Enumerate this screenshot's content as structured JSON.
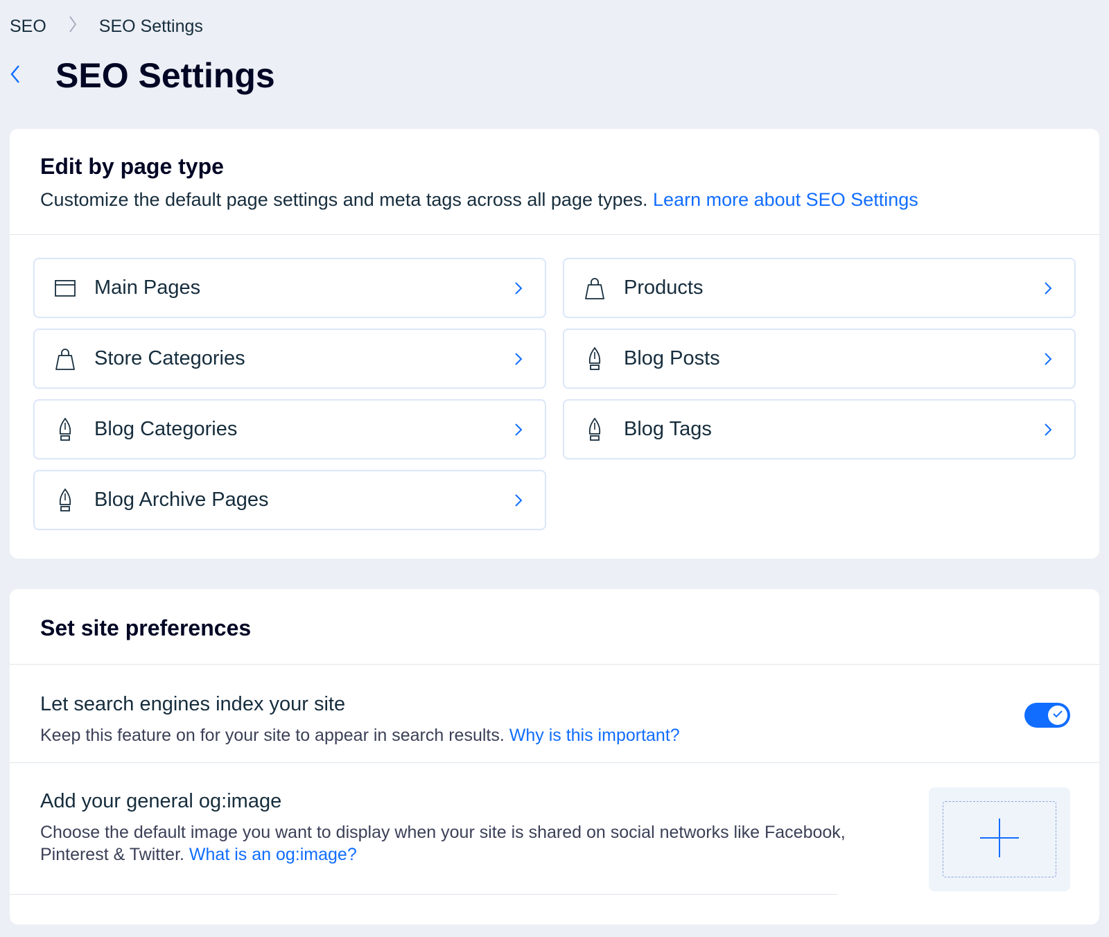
{
  "breadcrumb": {
    "root": "SEO",
    "current": "SEO Settings"
  },
  "header": {
    "title": "SEO Settings"
  },
  "page_types": {
    "title": "Edit by page type",
    "description": "Customize the default page settings and meta tags across all page types.",
    "learn_more": "Learn more about SEO Settings",
    "items": [
      {
        "label": "Main Pages",
        "icon": "browser-window-icon"
      },
      {
        "label": "Products",
        "icon": "shopping-bag-icon"
      },
      {
        "label": "Store Categories",
        "icon": "shopping-bag-icon"
      },
      {
        "label": "Blog Posts",
        "icon": "pen-nib-icon"
      },
      {
        "label": "Blog Categories",
        "icon": "pen-nib-icon"
      },
      {
        "label": "Blog Tags",
        "icon": "pen-nib-icon"
      },
      {
        "label": "Blog Archive Pages",
        "icon": "pen-nib-icon"
      }
    ]
  },
  "preferences": {
    "title": "Set site preferences",
    "index": {
      "title": "Let search engines index your site",
      "description": "Keep this feature on for your site to appear in search results.",
      "link": "Why is this important?",
      "enabled": true
    },
    "og_image": {
      "title": "Add your general og:image",
      "description": "Choose the default image you want to display when your site is shared on social networks like Facebook, Pinterest & Twitter.",
      "link": "What is an og:image?"
    }
  },
  "colors": {
    "accent": "#116dff",
    "background": "#eceff5",
    "tile_border": "#dbe6f9"
  }
}
